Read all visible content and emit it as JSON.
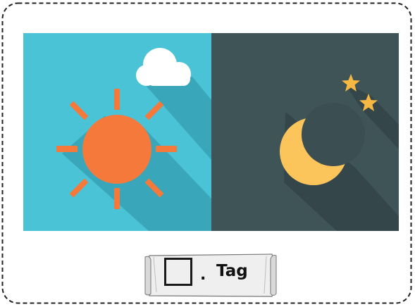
{
  "panels": {
    "day": {
      "name": "day",
      "background": "#4bc3d6",
      "sun_color": "#f5793b",
      "cloud_color": "#ffffff"
    },
    "night": {
      "name": "night",
      "background": "#3f5457",
      "moon_color": "#fcc55b",
      "star_color": "#f7b843"
    }
  },
  "caption": {
    "blank_label": "",
    "separator": ".",
    "word": "Tag"
  },
  "icons": [
    "sun-icon",
    "cloud-icon",
    "moon-icon",
    "star-icon"
  ]
}
